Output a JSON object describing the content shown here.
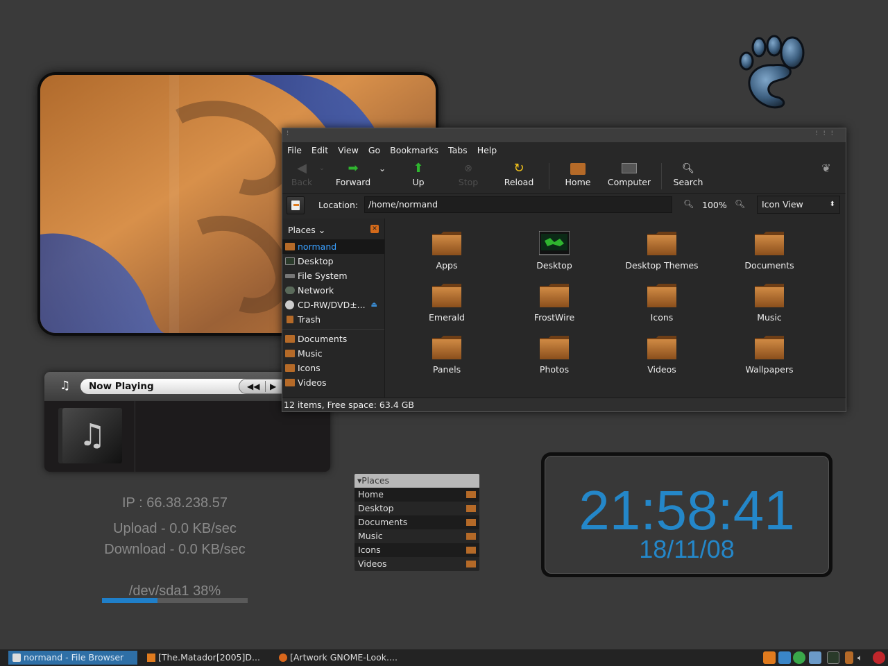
{
  "file_browser": {
    "menu": [
      "File",
      "Edit",
      "View",
      "Go",
      "Bookmarks",
      "Tabs",
      "Help"
    ],
    "toolbar": {
      "back": "Back",
      "forward": "Forward",
      "up": "Up",
      "stop": "Stop",
      "reload": "Reload",
      "home": "Home",
      "computer": "Computer",
      "search": "Search"
    },
    "location_label": "Location:",
    "location_value": "/home/normand",
    "zoom": "100%",
    "view_mode": "Icon View",
    "sidebar": {
      "title": "Places",
      "items": [
        {
          "label": "normand",
          "icon": "home-folder-icon"
        },
        {
          "label": "Desktop",
          "icon": "desktop-icon"
        },
        {
          "label": "File System",
          "icon": "filesystem-icon"
        },
        {
          "label": "Network",
          "icon": "network-icon"
        },
        {
          "label": "CD-RW/DVD±...",
          "icon": "cdrom-icon"
        },
        {
          "label": "Trash",
          "icon": "trash-icon"
        }
      ],
      "bookmarks": [
        "Documents",
        "Music",
        "Icons",
        "Videos"
      ]
    },
    "files": [
      "Apps",
      "Desktop",
      "Desktop Themes",
      "Documents",
      "Emerald",
      "FrostWire",
      "Icons",
      "Music",
      "Panels",
      "Photos",
      "Videos",
      "Wallpapers"
    ],
    "status": "12 items, Free space: 63.4 GB"
  },
  "music_player": {
    "now_playing": "Now Playing"
  },
  "stats": {
    "ip": "IP : 66.38.238.57",
    "upload": "Upload - 0.0 KB/sec",
    "download": "Download - 0.0 KB/sec",
    "disk": "/dev/sda1 38%",
    "disk_fraction": 0.38
  },
  "places_panel": {
    "title": "Places",
    "items": [
      "Home",
      "Desktop",
      "Documents",
      "Music",
      "Icons",
      "Videos"
    ]
  },
  "clock": {
    "time": "21:58:41",
    "date": "18/11/08"
  },
  "taskbar": {
    "tasks": [
      {
        "label": "normand - File Browser",
        "active": true
      },
      {
        "label": "[The.Matador[2005]D...",
        "active": false
      },
      {
        "label": "[Artwork GNOME-Look....",
        "active": false
      }
    ]
  },
  "colors": {
    "accent": "#2487c9",
    "folder": "#b56a28",
    "selection_text": "#3aa0ff",
    "background": "#3a3a3a"
  }
}
